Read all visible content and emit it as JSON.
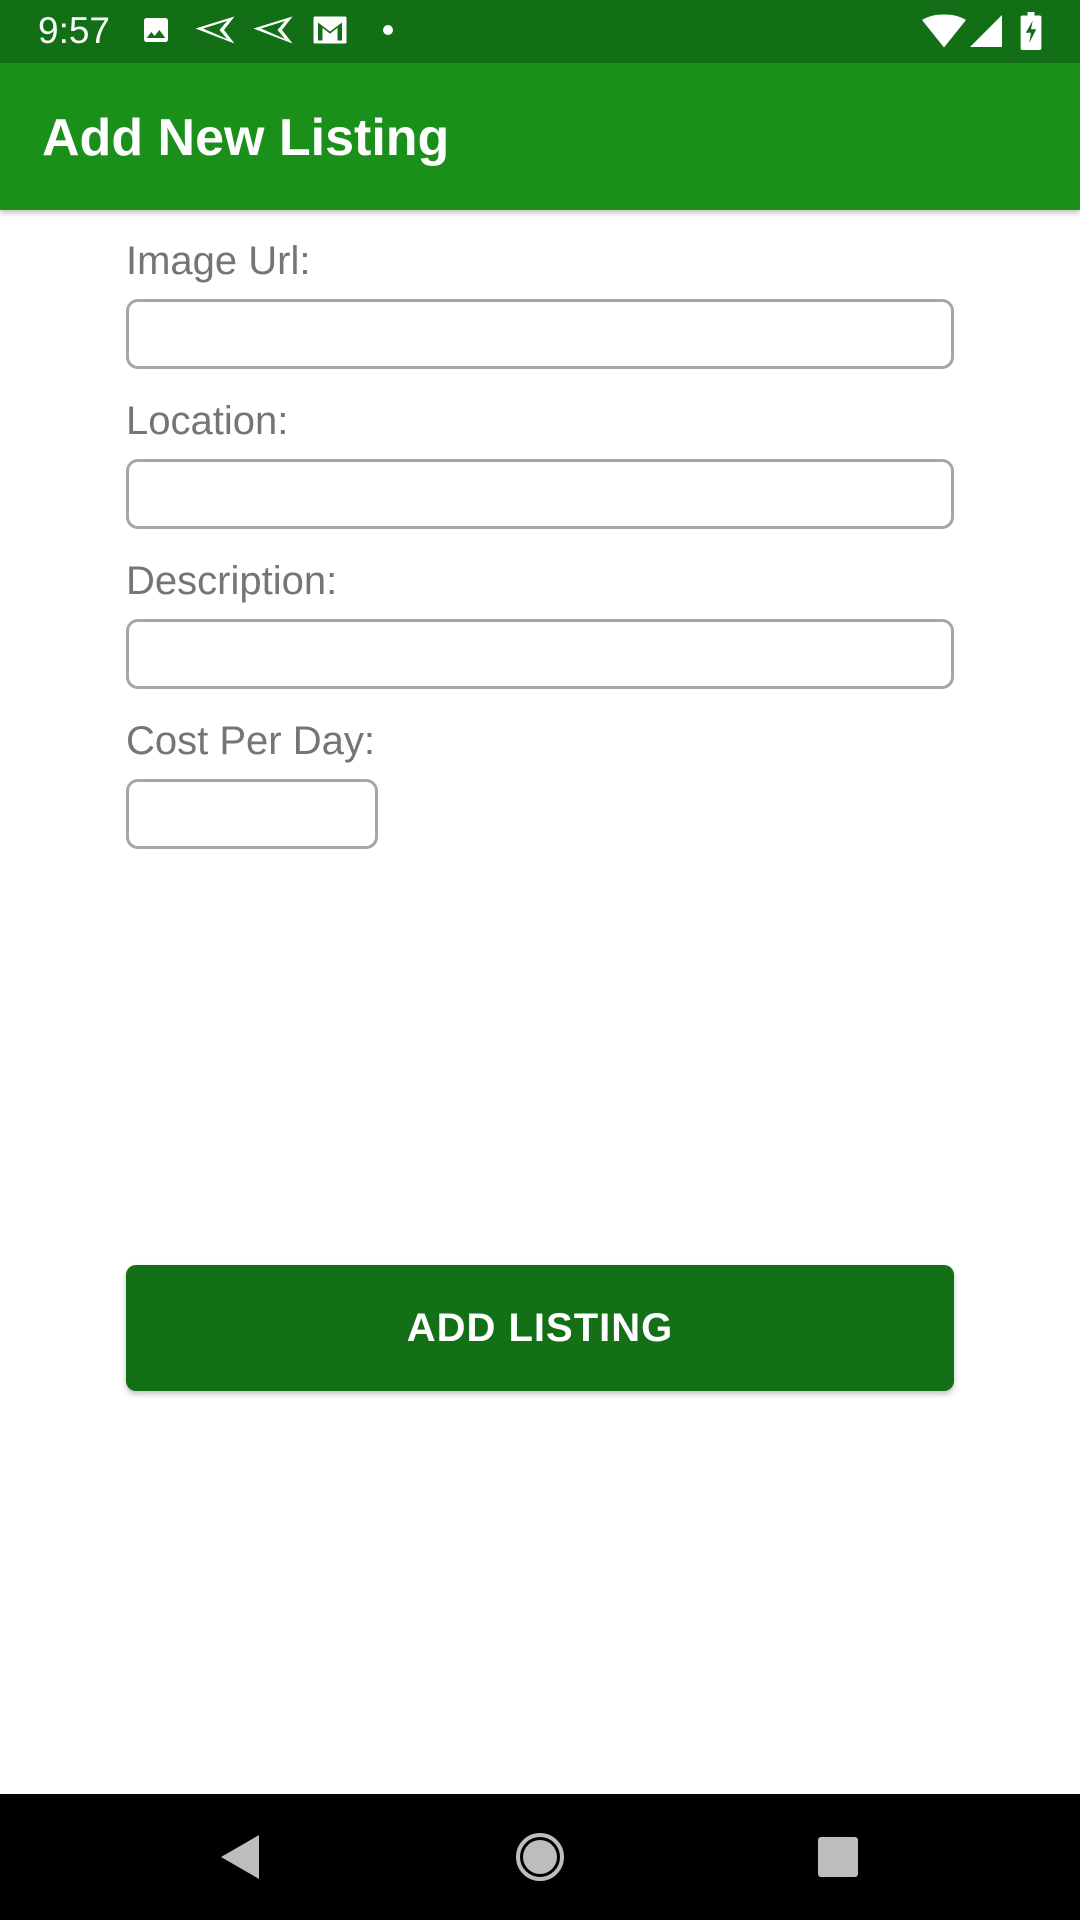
{
  "status_bar": {
    "time": "9:57",
    "left_icons": [
      "image-icon",
      "send-icon",
      "send-icon",
      "gmail-icon",
      "dot-icon"
    ],
    "right_icons": [
      "wifi-icon",
      "cellular-signal-icon",
      "battery-charging-icon"
    ]
  },
  "app_bar": {
    "title": "Add New Listing",
    "color": "#1a8f1a"
  },
  "form": {
    "image_url": {
      "label": "Image Url:",
      "value": "",
      "placeholder": ""
    },
    "location": {
      "label": "Location:",
      "value": "",
      "placeholder": ""
    },
    "description": {
      "label": "Description:",
      "value": "",
      "placeholder": ""
    },
    "cost_per_day": {
      "label": "Cost Per Day:",
      "value": "",
      "placeholder": ""
    },
    "submit_label": "ADD LISTING",
    "button_color": "#137016"
  },
  "nav_bar": {
    "icons": [
      "back-icon",
      "home-icon",
      "recents-icon"
    ]
  }
}
